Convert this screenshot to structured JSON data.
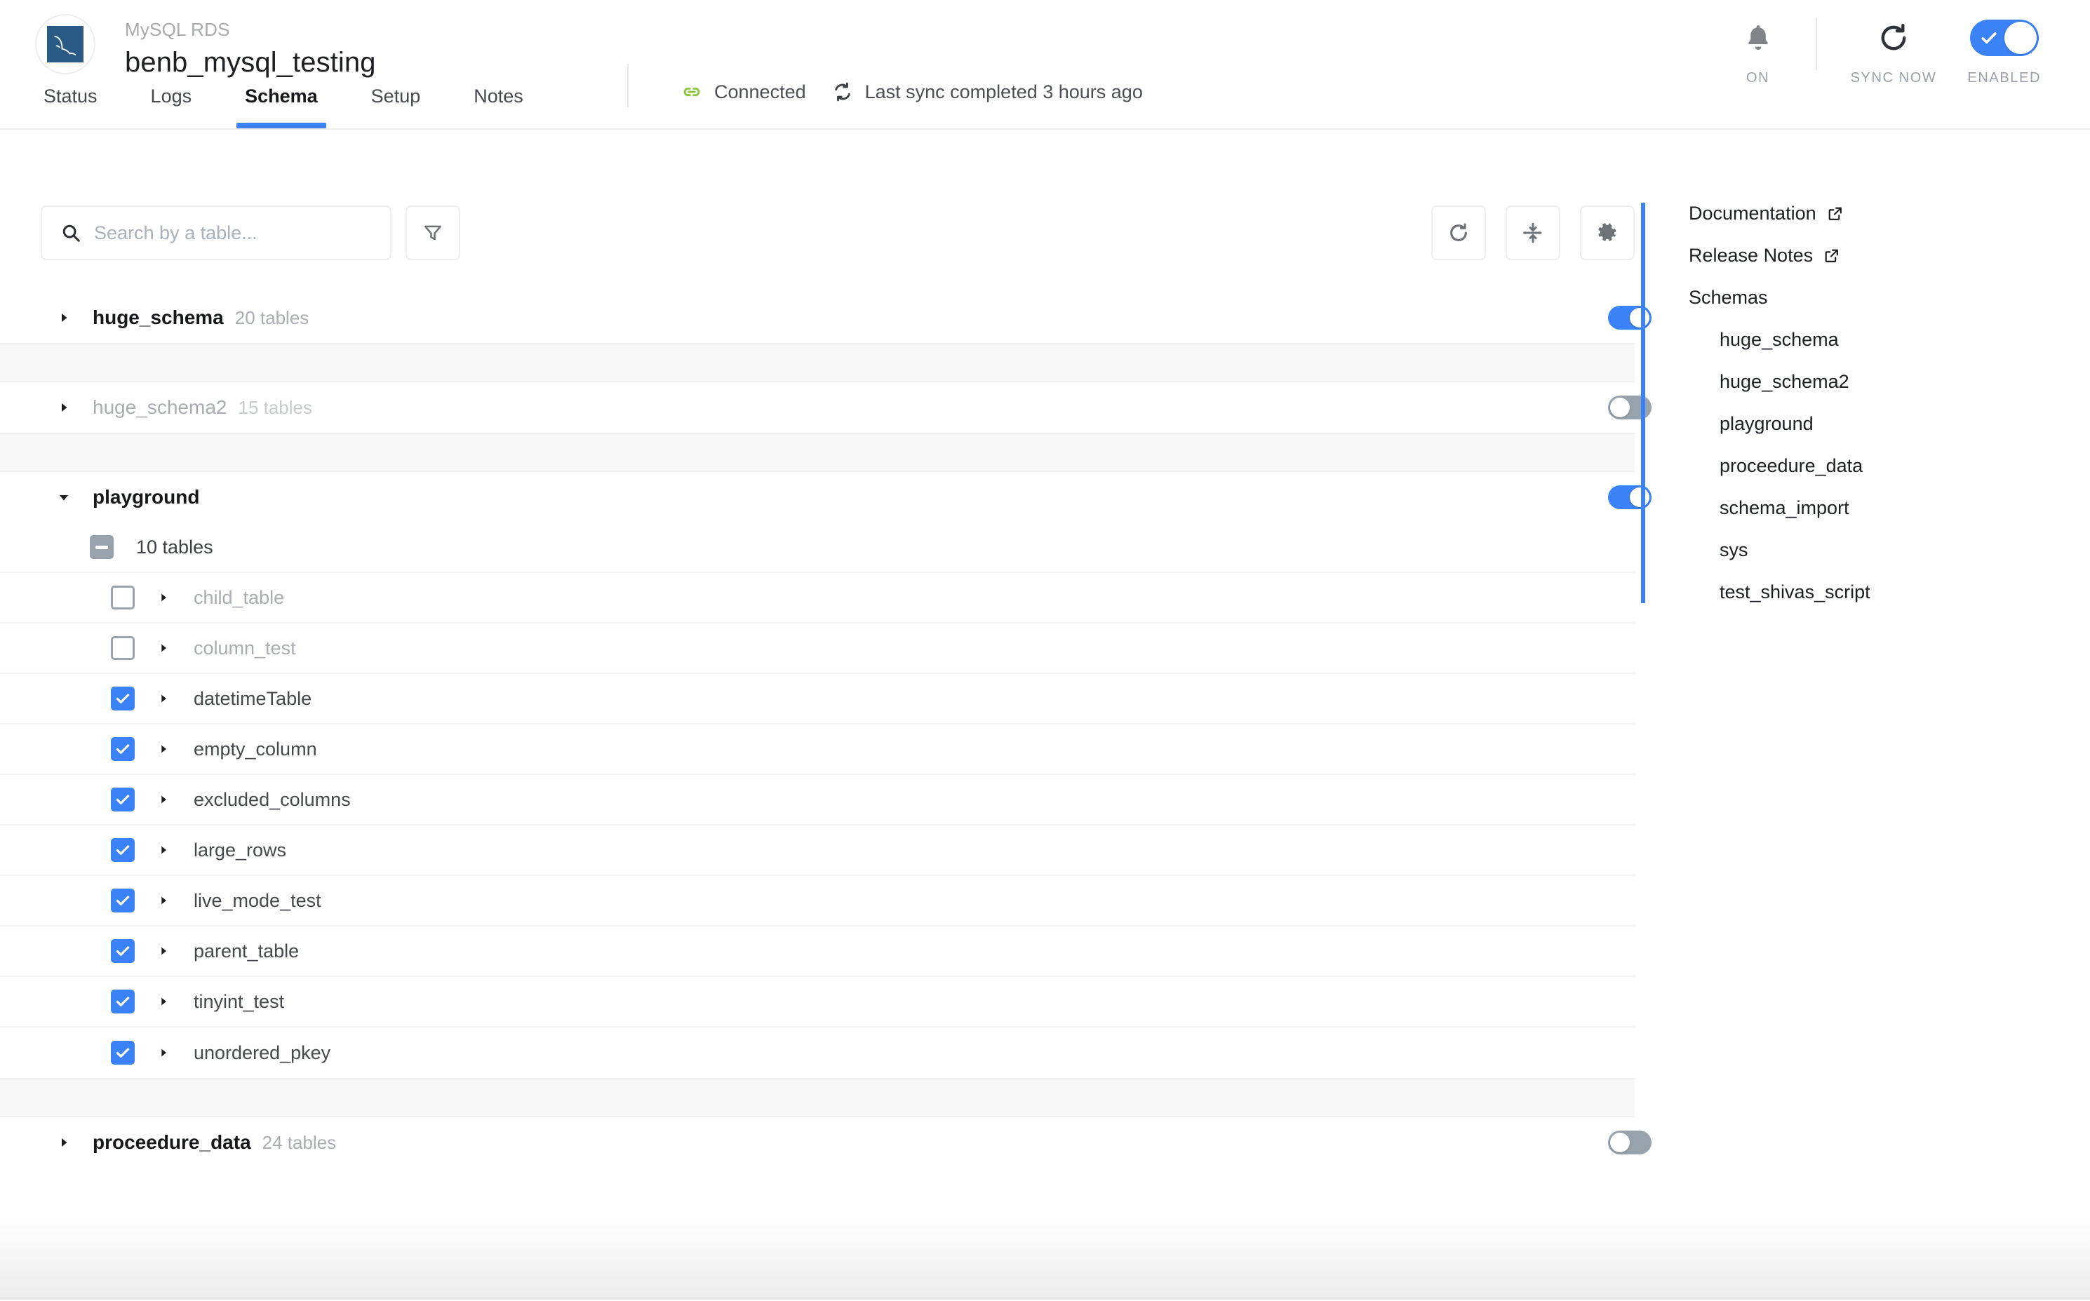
{
  "header": {
    "logo_icon": "mysql-dolphin-icon",
    "subtitle": "MySQL RDS",
    "title": "benb_mysql_testing",
    "tabs": [
      {
        "label": "Status",
        "active": false
      },
      {
        "label": "Logs",
        "active": false
      },
      {
        "label": "Schema",
        "active": true
      },
      {
        "label": "Setup",
        "active": false
      },
      {
        "label": "Notes",
        "active": false
      }
    ],
    "status": {
      "connection_icon": "link-icon",
      "connection_label": "Connected",
      "connection_color": "#8cc63f",
      "sync_icon": "sync-icon",
      "sync_label": "Last sync completed 3 hours ago"
    },
    "controls": [
      {
        "icon": "bell-icon",
        "caption": "ON",
        "kind": "icon"
      },
      {
        "icon": "reload-icon",
        "caption": "SYNC NOW",
        "kind": "icon"
      },
      {
        "icon": "toggle-checked-icon",
        "caption": "ENABLED",
        "kind": "toggle",
        "state": "on"
      }
    ],
    "accent_color": "#3b82f6"
  },
  "toolbar": {
    "search": {
      "icon": "search-icon",
      "value": "",
      "placeholder": "Search by a table..."
    },
    "filter_button": {
      "icon": "filter-icon",
      "label": ""
    },
    "actions": [
      {
        "icon": "refresh-icon",
        "label": ""
      },
      {
        "icon": "collapse-all-icon",
        "label": ""
      },
      {
        "icon": "gear-icon",
        "label": ""
      }
    ]
  },
  "tree": {
    "schemas": [
      {
        "name": "huge_schema",
        "count_label": "20 tables",
        "enabled": true,
        "expanded": false,
        "dim": false
      },
      {
        "name": "huge_schema2",
        "count_label": "15 tables",
        "enabled": false,
        "expanded": false,
        "dim": true
      },
      {
        "name": "playground",
        "count_label": "",
        "enabled": true,
        "expanded": true,
        "dim": false,
        "tables_count_label": "10 tables",
        "tables_checkbox_state": "indeterminate",
        "tables": [
          {
            "name": "child_table",
            "checked": false
          },
          {
            "name": "column_test",
            "checked": false
          },
          {
            "name": "datetimeTable",
            "checked": true
          },
          {
            "name": "empty_column",
            "checked": true
          },
          {
            "name": "excluded_columns",
            "checked": true
          },
          {
            "name": "large_rows",
            "checked": true
          },
          {
            "name": "live_mode_test",
            "checked": true
          },
          {
            "name": "parent_table",
            "checked": true
          },
          {
            "name": "tinyint_test",
            "checked": true
          },
          {
            "name": "unordered_pkey",
            "checked": true
          }
        ]
      },
      {
        "name": "proceedure_data",
        "count_label": "24 tables",
        "enabled": false,
        "expanded": false,
        "dim": false
      }
    ]
  },
  "sidebar": {
    "links": [
      {
        "label": "Documentation",
        "icon": "external-link-icon"
      },
      {
        "label": "Release Notes",
        "icon": "external-link-icon"
      }
    ],
    "section_heading": "Schemas",
    "schemas": [
      {
        "label": "huge_schema"
      },
      {
        "label": "huge_schema2"
      },
      {
        "label": "playground"
      },
      {
        "label": "proceedure_data"
      },
      {
        "label": "schema_import"
      },
      {
        "label": "sys"
      },
      {
        "label": "test_shivas_script"
      }
    ],
    "accent_color": "#3b82f6"
  }
}
